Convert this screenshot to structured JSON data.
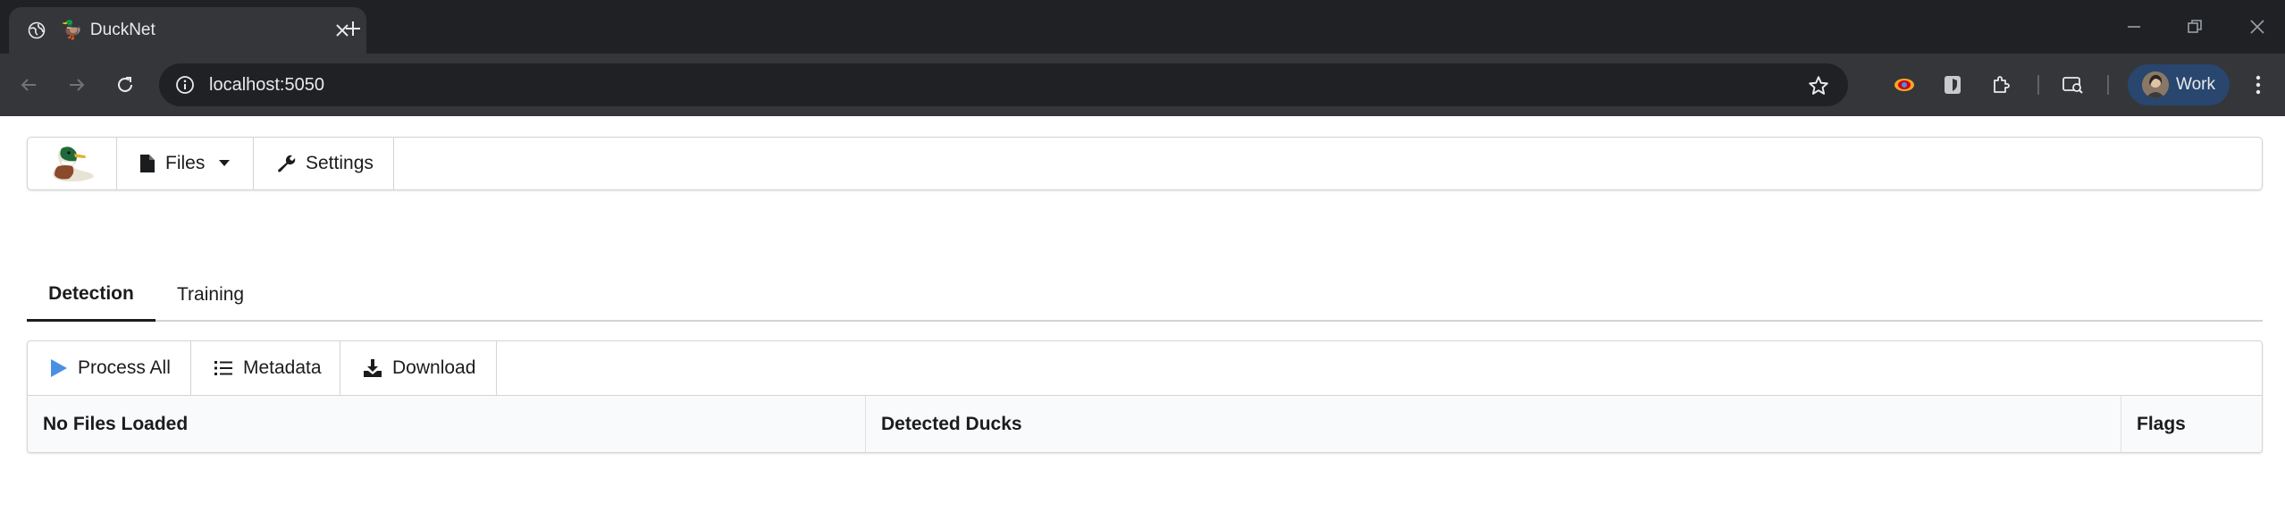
{
  "browser": {
    "tab_title": "DuckNet",
    "url": "localhost:5050",
    "profile_label": "Work"
  },
  "navbar": {
    "files_label": "Files",
    "settings_label": "Settings"
  },
  "tabs": [
    {
      "label": "Detection",
      "active": true
    },
    {
      "label": "Training",
      "active": false
    }
  ],
  "actions": {
    "process_all": "Process All",
    "metadata": "Metadata",
    "download": "Download"
  },
  "table": {
    "columns": [
      "No Files Loaded",
      "Detected Ducks",
      "Flags"
    ]
  },
  "colors": {
    "chrome_dark": "#202124",
    "chrome_toolbar": "#35363a",
    "profile_bg": "#28466e",
    "play_accent": "#4a90e2"
  }
}
